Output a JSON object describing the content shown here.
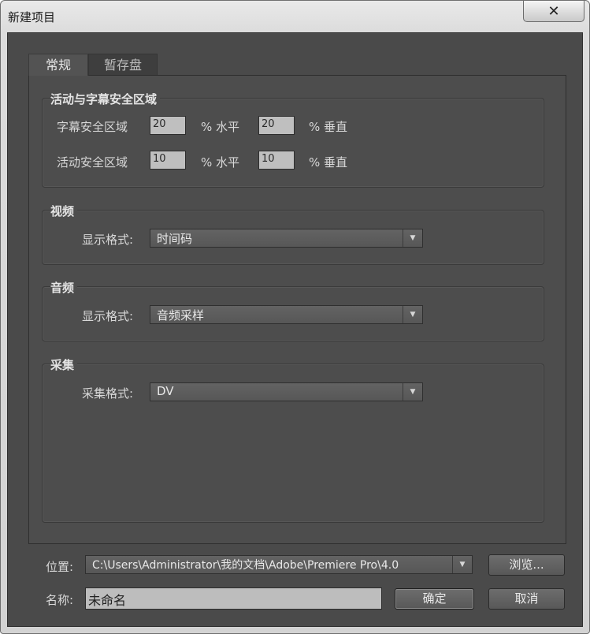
{
  "window": {
    "title": "新建项目",
    "close_glyph": "✕"
  },
  "tabs": [
    {
      "label": "常规",
      "active": true
    },
    {
      "label": "暂存盘",
      "active": false
    }
  ],
  "safe_areas": {
    "title": "活动与字幕安全区域",
    "title_safe": {
      "label": "字幕安全区域",
      "h_value": "20",
      "h_unit": "% 水平",
      "v_value": "20",
      "v_unit": "% 垂直"
    },
    "action_safe": {
      "label": "活动安全区域",
      "h_value": "10",
      "h_unit": "% 水平",
      "v_value": "10",
      "v_unit": "% 垂直"
    }
  },
  "video": {
    "title": "视频",
    "format_label": "显示格式:",
    "format_value": "时间码"
  },
  "audio": {
    "title": "音频",
    "format_label": "显示格式:",
    "format_value": "音频采样"
  },
  "capture": {
    "title": "采集",
    "format_label": "采集格式:",
    "format_value": "DV"
  },
  "location": {
    "label": "位置:",
    "value": "C:\\Users\\Administrator\\我的文档\\Adobe\\Premiere Pro\\4.0",
    "browse_label": "浏览..."
  },
  "name": {
    "label": "名称:",
    "value": "未命名"
  },
  "buttons": {
    "ok": "确定",
    "cancel": "取消"
  },
  "icons": {
    "dropdown_arrow": "▼"
  }
}
